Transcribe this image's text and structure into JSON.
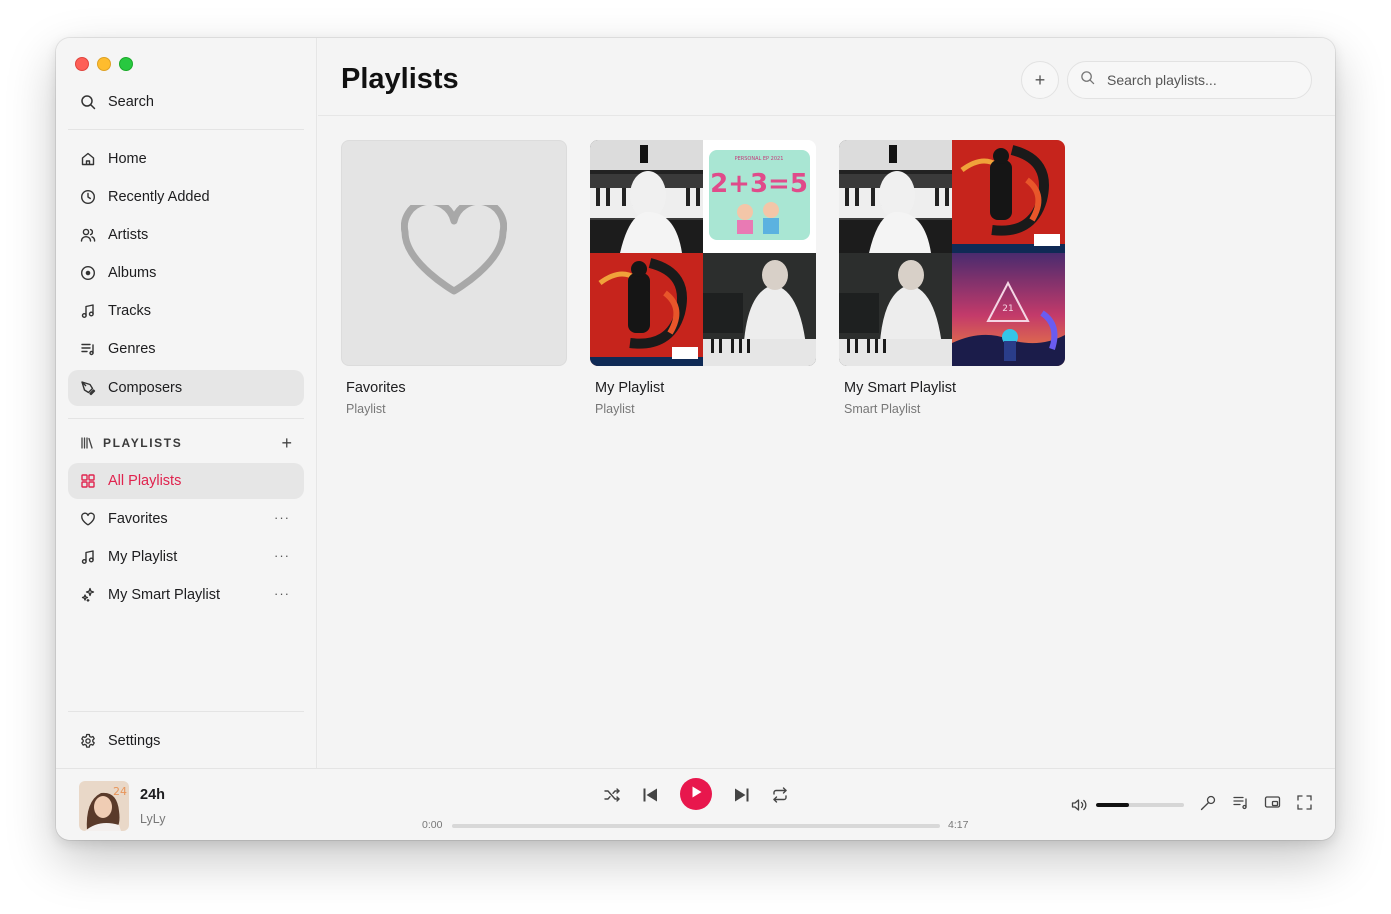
{
  "sidebar": {
    "search_label": "Search",
    "nav": [
      {
        "label": "Home",
        "icon": "home-icon"
      },
      {
        "label": "Recently Added",
        "icon": "clock-icon"
      },
      {
        "label": "Artists",
        "icon": "users-icon"
      },
      {
        "label": "Albums",
        "icon": "disc-icon"
      },
      {
        "label": "Tracks",
        "icon": "music-note-icon"
      },
      {
        "label": "Genres",
        "icon": "list-music-icon"
      },
      {
        "label": "Composers",
        "icon": "pen-icon"
      }
    ],
    "playlists_heading": "PLAYLISTS",
    "add_symbol": "+",
    "playlists": [
      {
        "label": "All Playlists",
        "icon": "grid-icon"
      },
      {
        "label": "Favorites",
        "icon": "heart-icon",
        "more": "···"
      },
      {
        "label": "My Playlist",
        "icon": "music-note-icon",
        "more": "···"
      },
      {
        "label": "My Smart Playlist",
        "icon": "sparkles-icon",
        "more": "···"
      }
    ],
    "settings_label": "Settings"
  },
  "header": {
    "title": "Playlists",
    "add_symbol": "+",
    "search_placeholder": "Search playlists..."
  },
  "cards": [
    {
      "title": "Favorites",
      "subtitle": "Playlist"
    },
    {
      "title": "My Playlist",
      "subtitle": "Playlist"
    },
    {
      "title": "My Smart Playlist",
      "subtitle": "Smart Playlist"
    }
  ],
  "artwork_text": {
    "math": "2+3=5",
    "math_caption": "PERSONAL EP 2021",
    "number": "21",
    "np_badge": "24"
  },
  "player": {
    "title": "24h",
    "artist": "LyLy",
    "elapsed": "0:00",
    "duration": "4:17",
    "progress": 0,
    "volume": 0.38
  },
  "colors": {
    "accent": "#e8174d",
    "active_text": "#e0234e"
  }
}
